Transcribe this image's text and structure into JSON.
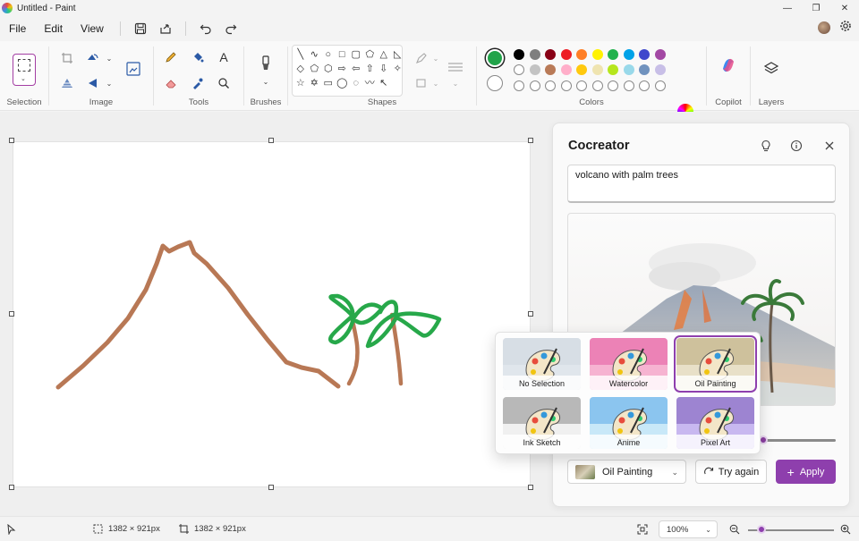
{
  "window": {
    "title": "Untitled - Paint",
    "minimize": "—",
    "maximize": "❐",
    "close": "✕"
  },
  "menu": {
    "file": "File",
    "edit": "Edit",
    "view": "View"
  },
  "ribbon": {
    "groups": {
      "selection": "Selection",
      "image": "Image",
      "tools": "Tools",
      "brushes": "Brushes",
      "shapes": "Shapes",
      "colors": "Colors",
      "copilot": "Copilot",
      "layers": "Layers"
    },
    "shapes": [
      "╲",
      "∿",
      "○",
      "□",
      "▢",
      "⬠",
      "△",
      "◺",
      "◇",
      "⬠",
      "⬡",
      "⇨",
      "⇦",
      "⇧",
      "⇩",
      "✧",
      "☆",
      "✡",
      "▭",
      "◯",
      "◌",
      "〰",
      "↖"
    ],
    "colors": {
      "current": "#22a34a",
      "row1": [
        "#000000",
        "#7f7f7f",
        "#880015",
        "#ed1c24",
        "#ff7f27",
        "#fff200",
        "#22b14c",
        "#00a2e8",
        "#3f48cc",
        "#a349a4"
      ],
      "row2": [
        "#ffffff",
        "#c3c3c3",
        "#b97a57",
        "#ffaec9",
        "#ffc90e",
        "#efe4b0",
        "#b5e61d",
        "#99d9ea",
        "#7092be",
        "#c8bfe7"
      ],
      "row3_empty_count": "10"
    }
  },
  "cocreator": {
    "title": "Cocreator",
    "prompt": "volcano with palm trees",
    "style_selected": "Oil Painting",
    "try_again": "Try again",
    "apply": "Apply",
    "styles": [
      {
        "label": "No Selection",
        "palette": [
          "#d0d7e0",
          "#e0e6ec"
        ]
      },
      {
        "label": "Watercolor",
        "palette": [
          "#e35aa0",
          "#f6b3d1"
        ]
      },
      {
        "label": "Oil Painting",
        "palette": [
          "#b8a878",
          "#e8e0c8"
        ]
      },
      {
        "label": "Ink Sketch",
        "palette": [
          "#8a8a8a",
          "#f0f0f0"
        ]
      },
      {
        "label": "Anime",
        "palette": [
          "#5aa8e8",
          "#c8e8f8"
        ]
      },
      {
        "label": "Pixel Art",
        "palette": [
          "#7a5ab8",
          "#c8b8f0"
        ]
      }
    ]
  },
  "status": {
    "selection_size": "1382 × 921px",
    "canvas_size": "1382 × 921px",
    "zoom": "100%"
  }
}
